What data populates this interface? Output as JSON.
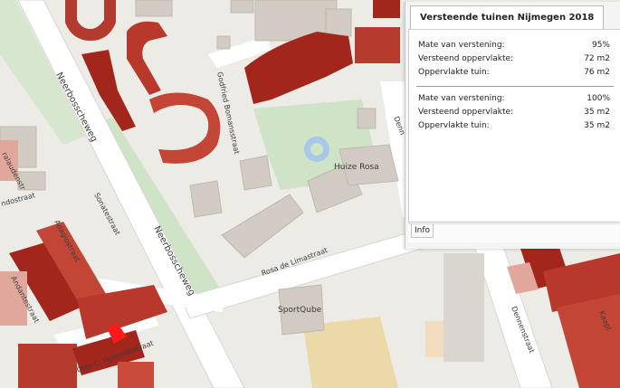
{
  "panel": {
    "title": "Versteende tuinen Nijmegen 2018",
    "sections": [
      {
        "rows": [
          {
            "label": "Mate van verstening:",
            "value": "95%"
          },
          {
            "label": "Versteend oppervlakte:",
            "value": "72 m2"
          },
          {
            "label": "Oppervlakte tuin:",
            "value": "76 m2"
          }
        ]
      },
      {
        "rows": [
          {
            "label": "Mate van verstening:",
            "value": "100%"
          },
          {
            "label": "Versteend oppervlakte:",
            "value": "35 m2"
          },
          {
            "label": "Oppervlakte tuin:",
            "value": "35 m2"
          }
        ]
      }
    ],
    "footer_tab": "Info"
  },
  "map": {
    "labels": {
      "neerbosscheweg_top": "Neerbosscheweg",
      "neerbosscheweg_bottom": "Neerbosscheweg",
      "sonatestraat": "Sonatestraat",
      "adagiostraat": "Adagiostraat",
      "andantestraat": "Andantestraat",
      "godfried": "Godfried Bomansstraat",
      "rosa": "Rosa de Limastraat",
      "otto": "Otto C. Huismanstraat",
      "huize_rosa": "Huize Rosa",
      "sportqube": "SportQube",
      "dennenstraat": "Dennenstraat",
      "kaapi": "Kaapl",
      "left_edge_a": "ralaudenstr",
      "left_edge_b": "ndostraat",
      "denne_top": "Denn"
    },
    "colors": {
      "background": "#ecebe6",
      "road": "#ffffff",
      "green": "#cfe3c6",
      "building": "#d1cbc3",
      "stone_high": "#a3261c",
      "stone_mid": "#c94b3c",
      "stone_low": "#e2a79c",
      "selected": "#ff1a1a",
      "water": "#a8c8e8",
      "sand": "#ecd9a8"
    },
    "selected_feature": "parcel-highlight"
  }
}
